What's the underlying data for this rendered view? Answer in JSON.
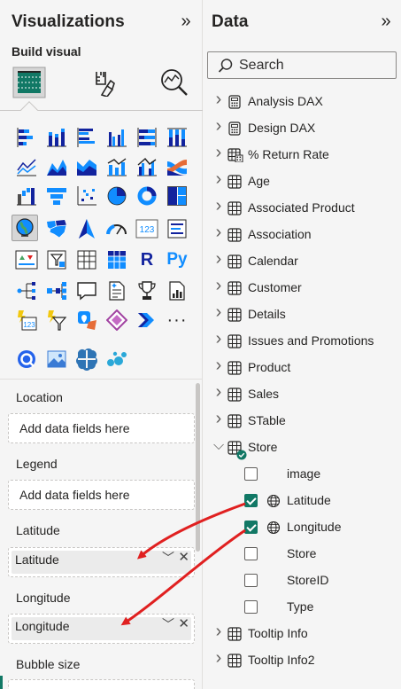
{
  "visualizations": {
    "title": "Visualizations",
    "build_visual_label": "Build visual",
    "r_label": "R",
    "py_label": "Py",
    "card_label": "123",
    "kpi_label": "123"
  },
  "field_wells": {
    "location": {
      "label": "Location",
      "placeholder": "Add data fields here"
    },
    "legend": {
      "label": "Legend",
      "placeholder": "Add data fields here"
    },
    "latitude": {
      "label": "Latitude",
      "field": "Latitude"
    },
    "longitude": {
      "label": "Longitude",
      "field": "Longitude"
    },
    "bubble_size": {
      "label": "Bubble size"
    }
  },
  "data": {
    "title": "Data",
    "search_placeholder": "Search",
    "tables": [
      {
        "name": "Analysis DAX",
        "icon": "calculator-icon"
      },
      {
        "name": "Design DAX",
        "icon": "calculator-icon"
      },
      {
        "name": "% Return Rate",
        "icon": "calculated-table-icon"
      },
      {
        "name": "Age",
        "icon": "table-icon"
      },
      {
        "name": "Associated Product",
        "icon": "table-icon"
      },
      {
        "name": "Association",
        "icon": "table-icon"
      },
      {
        "name": "Calendar",
        "icon": "table-icon"
      },
      {
        "name": "Customer",
        "icon": "table-icon"
      },
      {
        "name": "Details",
        "icon": "table-icon"
      },
      {
        "name": "Issues and Promotions",
        "icon": "table-icon"
      },
      {
        "name": "Product",
        "icon": "table-icon"
      },
      {
        "name": "Sales",
        "icon": "table-icon"
      },
      {
        "name": "STable",
        "icon": "table-icon"
      },
      {
        "name": "Store",
        "icon": "table-icon",
        "expanded": true
      },
      {
        "name": "Tooltip Info",
        "icon": "table-icon"
      },
      {
        "name": "Tooltip Info2",
        "icon": "table-icon"
      }
    ],
    "store_fields": [
      {
        "name": "image",
        "checked": false,
        "geo": false
      },
      {
        "name": "Latitude",
        "checked": true,
        "geo": true
      },
      {
        "name": "Longitude",
        "checked": true,
        "geo": true
      },
      {
        "name": "Store",
        "checked": false,
        "geo": false
      },
      {
        "name": "StoreID",
        "checked": false,
        "geo": false
      },
      {
        "name": "Type",
        "checked": false,
        "geo": false
      }
    ]
  },
  "colors": {
    "accent_teal": "#117865",
    "bar_blue": "#118dff",
    "bar_dark": "#12239e",
    "annotation_red": "#e02020"
  }
}
